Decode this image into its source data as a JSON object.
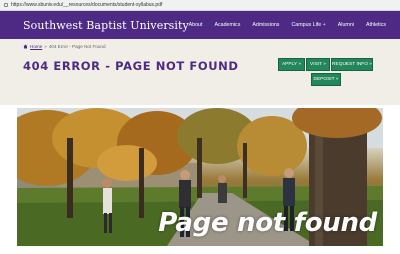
{
  "browser": {
    "url": "https://www.sbuniv.edu/__resources/documents/student-syllabus.pdf"
  },
  "header": {
    "brand": "Southwest Baptist University",
    "nav": [
      {
        "label": "About",
        "has_plus": false
      },
      {
        "label": "Academics",
        "has_plus": false
      },
      {
        "label": "Admissions",
        "has_plus": false
      },
      {
        "label": "Campus Life",
        "has_plus": true
      },
      {
        "label": "Alumni",
        "has_plus": false
      },
      {
        "label": "Athletics",
        "has_plus": false
      }
    ]
  },
  "breadcrumb": {
    "home": "Home",
    "separator": "»",
    "current": "404 Error - Page Not Found"
  },
  "page": {
    "title": "404 ERROR - PAGE NOT FOUND"
  },
  "cta": {
    "apply": "APPLY »",
    "visit": "VISIT »",
    "request_info": "REQUEST INFO »",
    "deposit": "DEPOSIT »"
  },
  "hero": {
    "overlay_text": "Page not found"
  },
  "colors": {
    "brand_purple": "#4e2a84",
    "cta_green": "#24875b",
    "band_beige": "#f0eee6"
  }
}
